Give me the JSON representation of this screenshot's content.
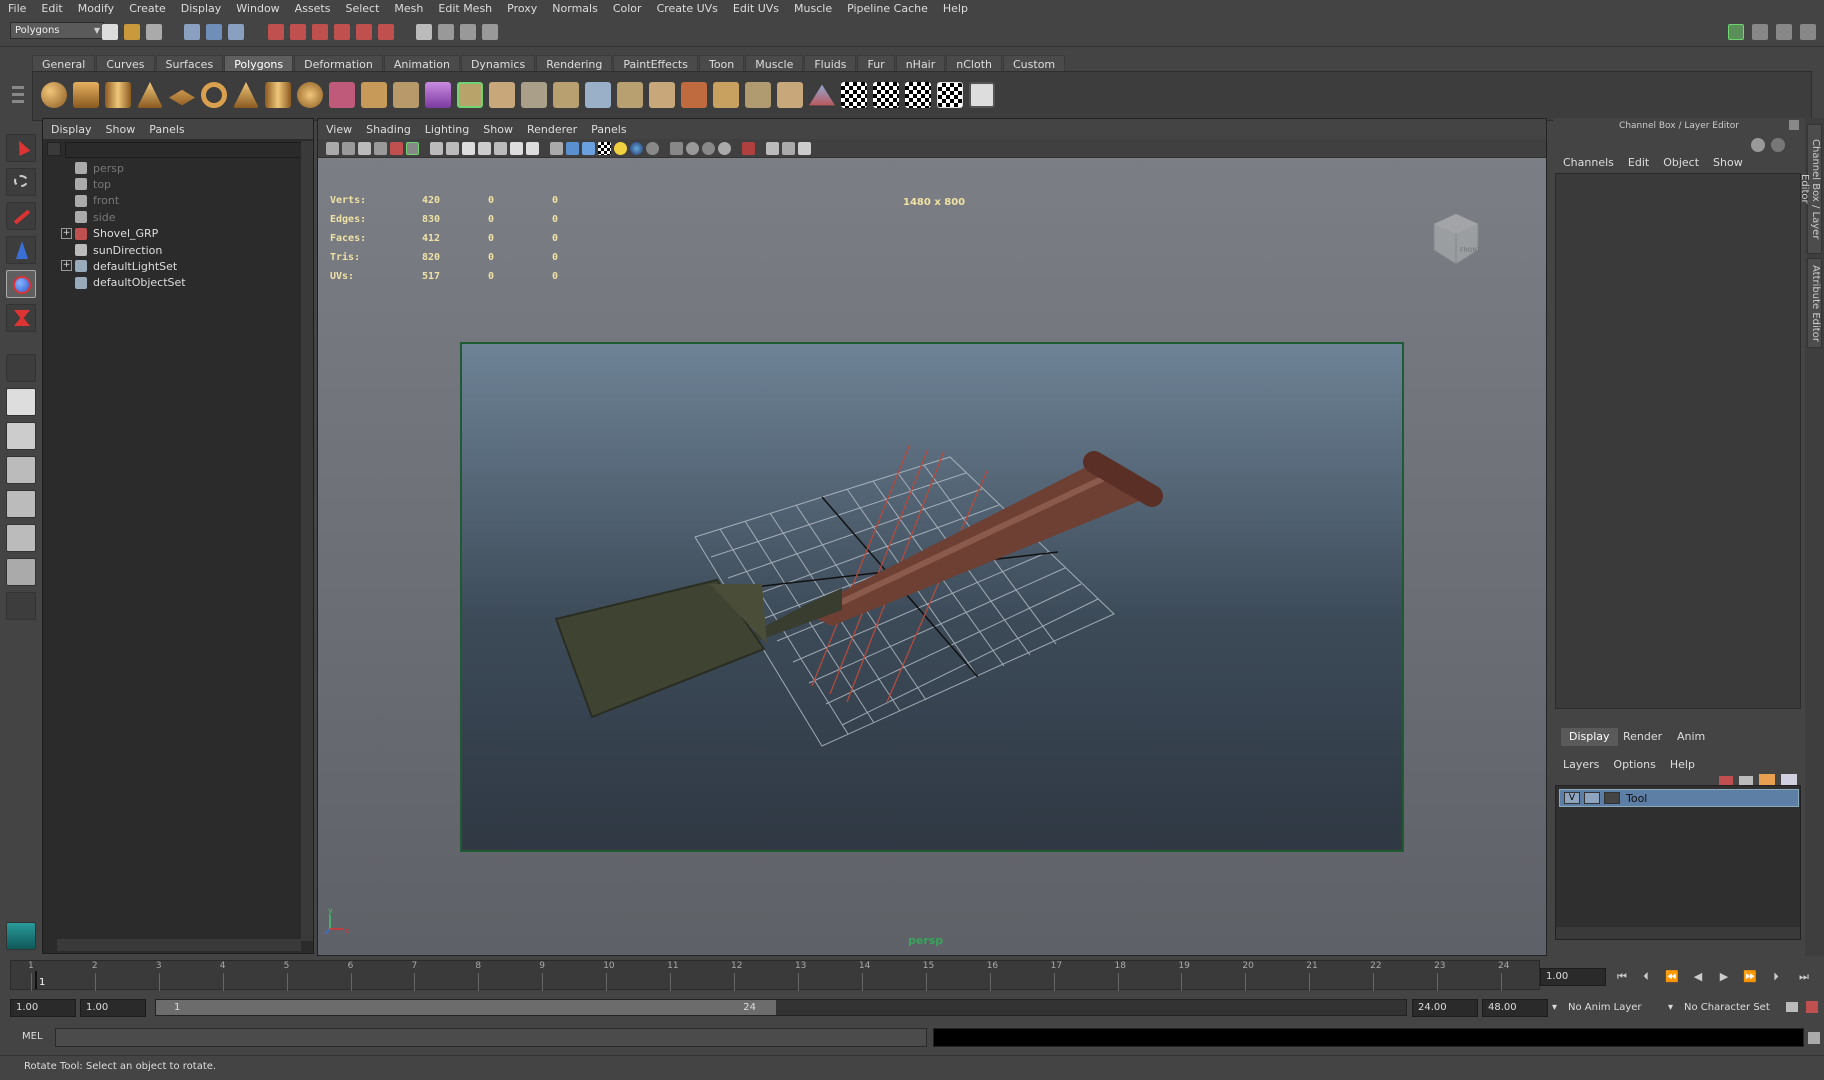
{
  "menubar": [
    "File",
    "Edit",
    "Modify",
    "Create",
    "Display",
    "Window",
    "Assets",
    "Select",
    "Mesh",
    "Edit Mesh",
    "Proxy",
    "Normals",
    "Color",
    "Create UVs",
    "Edit UVs",
    "Muscle",
    "Pipeline Cache",
    "Help"
  ],
  "status": {
    "mode": "Polygons"
  },
  "shelf": {
    "tabs": [
      "General",
      "Curves",
      "Surfaces",
      "Polygons",
      "Deformation",
      "Animation",
      "Dynamics",
      "Rendering",
      "PaintEffects",
      "Toon",
      "Muscle",
      "Fluids",
      "Fur",
      "nHair",
      "nCloth",
      "Custom"
    ],
    "active_tab": "Polygons"
  },
  "outliner": {
    "menu": [
      "Display",
      "Show",
      "Panels"
    ],
    "items": [
      "persp",
      "top",
      "front",
      "side",
      "Shovel_GRP",
      "sunDirection",
      "defaultLightSet",
      "defaultObjectSet"
    ]
  },
  "viewport": {
    "menu": [
      "View",
      "Shading",
      "Lighting",
      "Show",
      "Renderer",
      "Panels"
    ],
    "hud": [
      {
        "label": "Verts:",
        "a": "420",
        "b": "0",
        "c": "0"
      },
      {
        "label": "Edges:",
        "a": "830",
        "b": "0",
        "c": "0"
      },
      {
        "label": "Faces:",
        "a": "412",
        "b": "0",
        "c": "0"
      },
      {
        "label": "Tris:",
        "a": "820",
        "b": "0",
        "c": "0"
      },
      {
        "label": "UVs:",
        "a": "517",
        "b": "0",
        "c": "0"
      }
    ],
    "resolution": "1480 x 800",
    "camera": "persp",
    "axis": {
      "y": "y",
      "x": "x",
      "z": "z"
    },
    "viewcube_label": "FRONT"
  },
  "channelbox": {
    "title": "Channel Box / Layer Editor",
    "menu": [
      "Channels",
      "Edit",
      "Object",
      "Show"
    ],
    "layer_tabs": [
      "Display",
      "Render",
      "Anim"
    ],
    "active_layer_tab": "Display",
    "layer_menu": [
      "Layers",
      "Options",
      "Help"
    ],
    "layer": {
      "visible": "V",
      "name": "Tool"
    }
  },
  "sidetabs": [
    "Channel Box / Layer Editor",
    "Attribute Editor"
  ],
  "timeline": {
    "ticks": [
      "1",
      "2",
      "3",
      "4",
      "5",
      "6",
      "7",
      "8",
      "9",
      "10",
      "11",
      "12",
      "13",
      "14",
      "15",
      "16",
      "17",
      "18",
      "19",
      "20",
      "21",
      "22",
      "23",
      "24"
    ],
    "current_frame_marker": "1",
    "current_time": "1.00"
  },
  "range": {
    "start": "1.00",
    "anim_start": "1.00",
    "range_start_label": "1",
    "range_end_label": "24",
    "anim_end": "24.00",
    "end": "48.00",
    "anim_layer": "No Anim Layer",
    "char_set": "No Character Set"
  },
  "cmdline": {
    "label": "MEL"
  },
  "helpline": {
    "text": "Rotate Tool: Select an object to rotate."
  },
  "colors": {
    "hud": "#f0e1a4",
    "camera": "#37a55b",
    "selected_layer": "#5d7ea5"
  }
}
